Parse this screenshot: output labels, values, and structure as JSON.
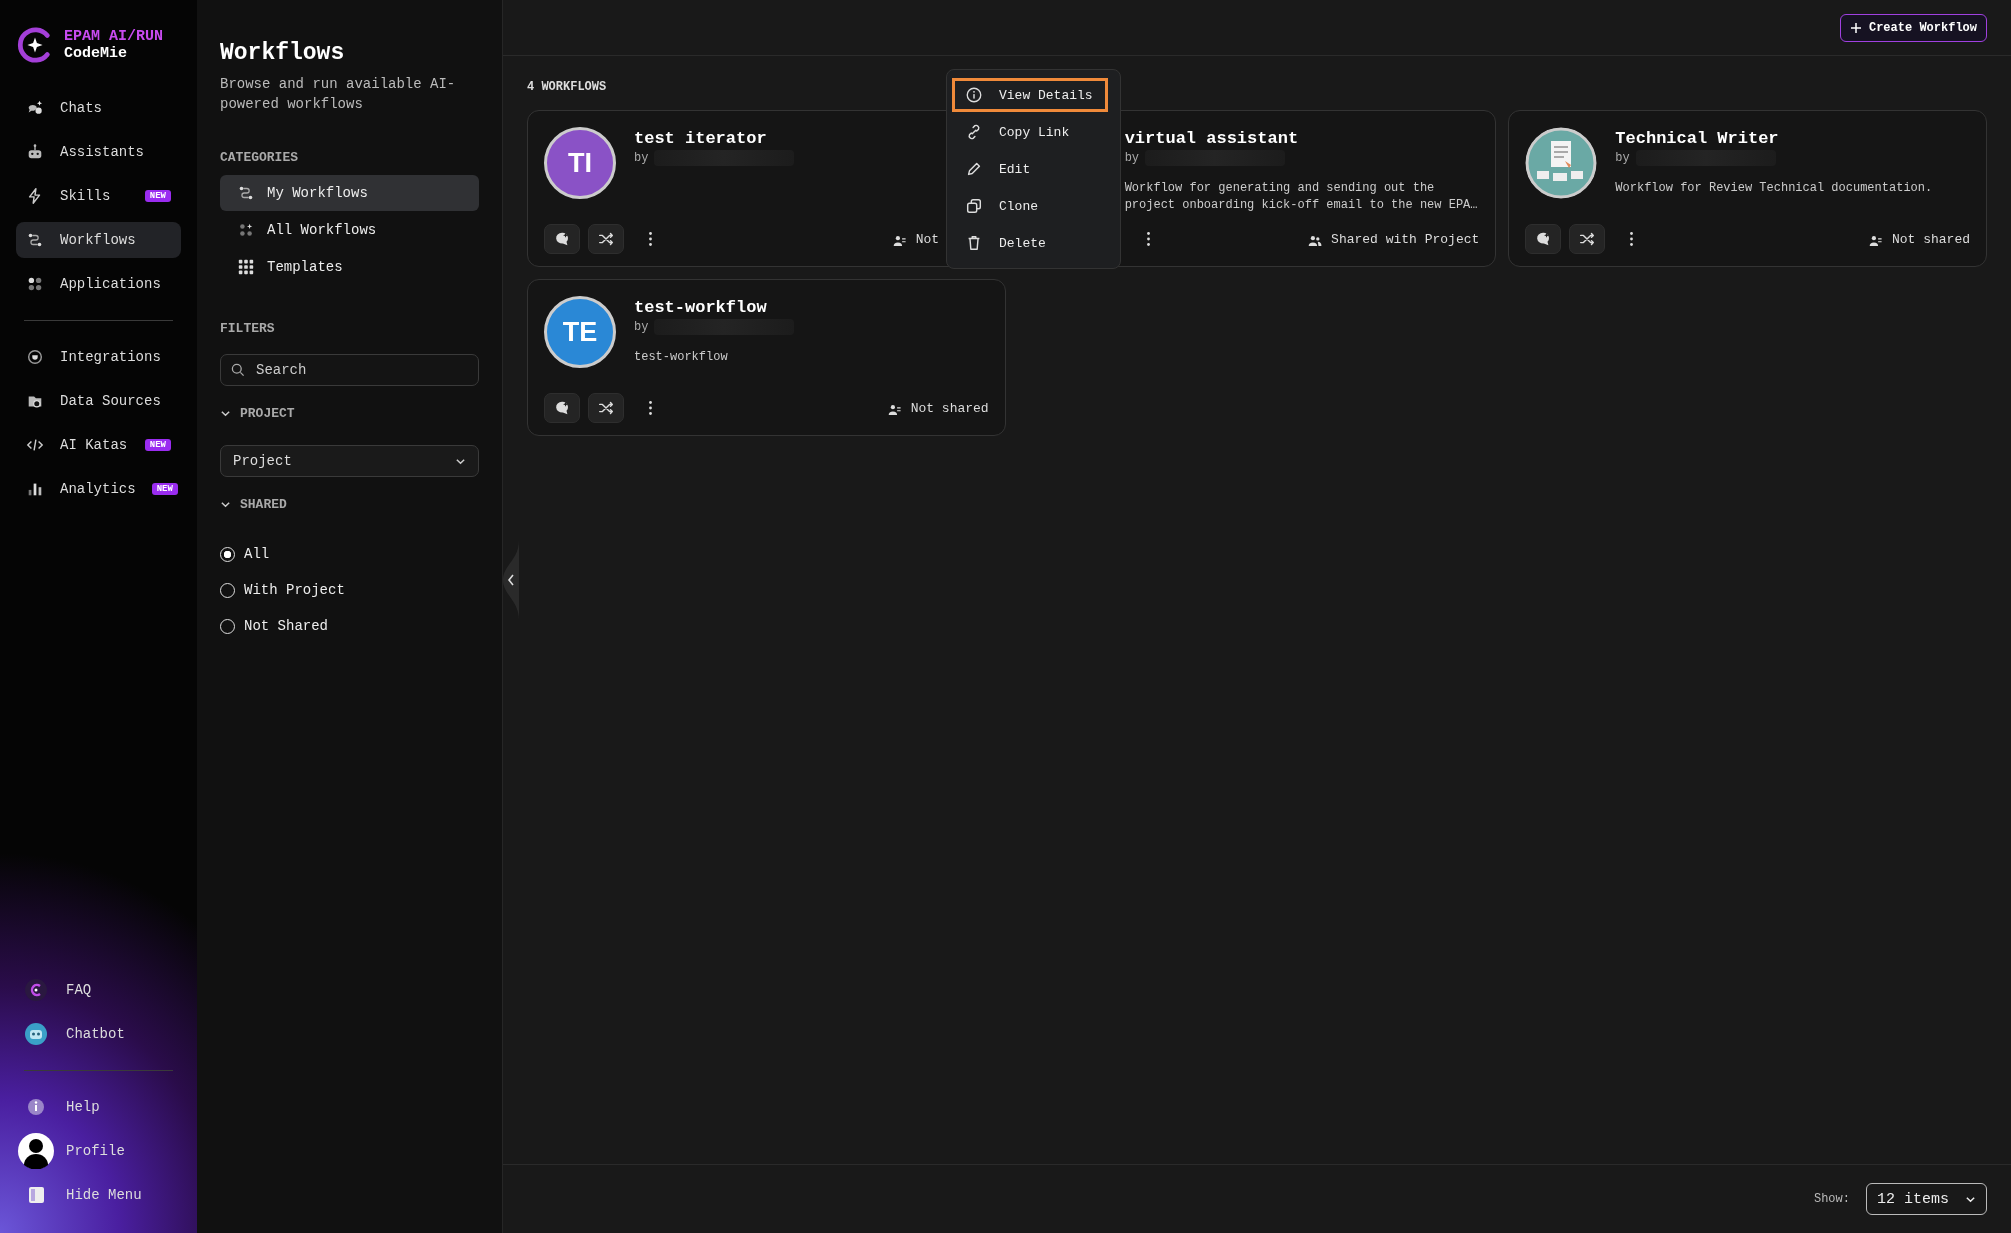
{
  "brand": {
    "line1": "EPAM AI/RUN",
    "line2": "CodeMie"
  },
  "nav": [
    {
      "label": "Chats",
      "selected": false
    },
    {
      "label": "Assistants",
      "selected": false
    },
    {
      "label": "Skills",
      "badge": "NEW",
      "selected": false
    },
    {
      "label": "Workflows",
      "selected": true
    },
    {
      "label": "Applications",
      "selected": false
    }
  ],
  "nav_tools": [
    {
      "label": "Integrations",
      "selected": false
    },
    {
      "label": "Data Sources",
      "selected": false
    },
    {
      "label": "AI Katas",
      "badge": "NEW",
      "selected": false
    },
    {
      "label": "Analytics",
      "badge": "NEW",
      "selected": false
    }
  ],
  "nav_bottom": [
    {
      "label": "FAQ"
    },
    {
      "label": "Chatbot"
    }
  ],
  "nav_account": [
    {
      "label": "Help"
    },
    {
      "label": "Profile"
    },
    {
      "label": "Hide Menu"
    }
  ],
  "panel": {
    "title": "Workflows",
    "subtitle": "Browse and run available AI-powered workflows",
    "categories_heading": "CATEGORIES",
    "categories": [
      {
        "label": "My Workflows",
        "selected": true
      },
      {
        "label": "All Workflows",
        "selected": false
      },
      {
        "label": "Templates",
        "selected": false
      }
    ],
    "filters_heading": "FILTERS",
    "search": {
      "placeholder": "Search"
    },
    "project_section": {
      "title": "PROJECT",
      "expanded": true
    },
    "project_select": {
      "value": "Project"
    },
    "shared_section": {
      "title": "SHARED",
      "expanded": true
    },
    "shared_options": [
      {
        "label": "All",
        "selected": true
      },
      {
        "label": "With Project",
        "selected": false
      },
      {
        "label": "Not Shared",
        "selected": false
      }
    ]
  },
  "toolbar": {
    "create_button": "Create Workflow"
  },
  "count_label": "4 WORKFLOWS",
  "workflows": [
    {
      "title": "test iterator",
      "by": "by",
      "avatar": {
        "kind": "initials",
        "text": "TI",
        "color": "#8a52c6"
      },
      "actions": [
        {
          "kind": "chat"
        },
        {
          "kind": "shuffle"
        },
        {
          "kind": "more"
        }
      ],
      "sharing": {
        "kind": "private",
        "label": "Not"
      }
    },
    {
      "title": "virtual assistant",
      "by": "by",
      "description_lines": [
        "Workflow for generating and sending out the",
        "project onboarding kick-off email to the new EPA…"
      ],
      "actions": [
        {
          "kind": "more"
        }
      ],
      "sharing": {
        "kind": "project",
        "label": "Shared with Project"
      }
    },
    {
      "title": "Technical Writer",
      "by": "by",
      "avatar": {
        "kind": "picture"
      },
      "description_lines": [
        "Workflow for Review Technical documentation."
      ],
      "actions": [
        {
          "kind": "chat"
        },
        {
          "kind": "shuffle"
        },
        {
          "kind": "more"
        }
      ],
      "sharing": {
        "kind": "private",
        "label": "Not shared"
      }
    },
    {
      "title": "test-workflow",
      "by": "by",
      "avatar": {
        "kind": "initials",
        "text": "TE",
        "color": "#2a88d6"
      },
      "description_lines": [
        "test-workflow"
      ],
      "actions": [
        {
          "kind": "chat"
        },
        {
          "kind": "shuffle"
        },
        {
          "kind": "more"
        }
      ],
      "sharing": {
        "kind": "private",
        "label": "Not shared"
      }
    }
  ],
  "context_menu": {
    "items": [
      {
        "label": "View Details",
        "selected": true
      },
      {
        "label": "Copy Link",
        "selected": false
      },
      {
        "label": "Edit",
        "selected": false
      },
      {
        "label": "Clone",
        "selected": false
      },
      {
        "label": "Delete",
        "selected": false
      }
    ]
  },
  "footer": {
    "show_label": "Show:",
    "page_size": "12 items"
  }
}
